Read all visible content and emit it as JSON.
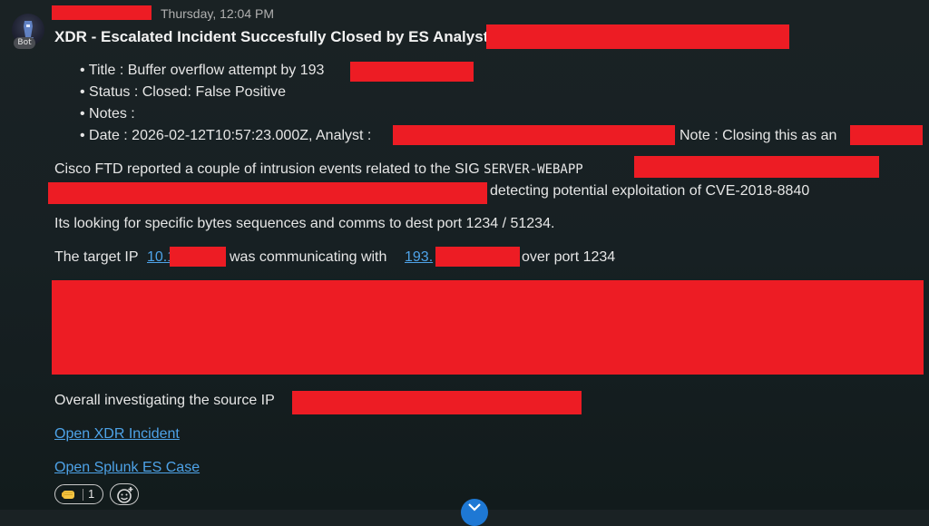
{
  "message": {
    "avatar_badge": "Bot",
    "timestamp": "Thursday, 12:04 PM",
    "title": "XDR  - Escalated Incident Succesfully Closed by ES Analyst",
    "bullets": {
      "title": "Title : Buffer overflow attempt by 193",
      "status": "Status : Closed: False Positive",
      "notes": "Notes :",
      "date": "Date : 2026-02-12T10:57:23.000Z, Analyst :",
      "note": "Note : Closing this as an"
    },
    "paragraphs": {
      "cisco_prefix": "Cisco FTD reported a couple of intrusion events  related to the SIG",
      "sig_code": "SERVER-WEBAPP",
      "detecting": "detecting potential exploitation of CVE-2018-8840",
      "looking": "Its looking for specific bytes sequences and comms to dest port 1234 / 51234.",
      "target_prefix": "The target IP",
      "target_ip_link": "10.1",
      "target_middle": "was communicating with",
      "source_ip_link": "193.",
      "target_suffix": "over port 1234",
      "overall": "Overall investigating the source IP"
    },
    "links": {
      "xdr": "Open XDR Incident",
      "splunk": "Open Splunk ES Case"
    },
    "reactions": {
      "fist_emoji": "fist-bump-icon",
      "fist_count": "1",
      "add_reaction": "add-reaction-icon"
    },
    "scroll_fab_icon": "chevron-down-icon"
  },
  "colors": {
    "background": "#172023",
    "redaction": "#ed1c24",
    "link": "#4ea3e8",
    "text": "#e6e6e6",
    "fab": "#1e78d4"
  }
}
